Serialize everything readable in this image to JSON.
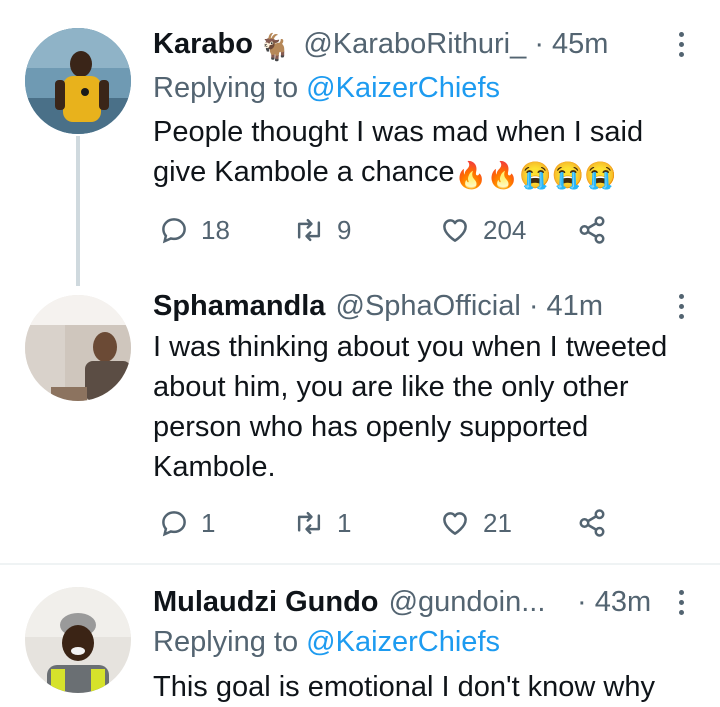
{
  "tweets": [
    {
      "name": "Karabo",
      "name_emoji": "🐐",
      "handle": "@KaraboRithuri_",
      "time": "· 45m",
      "replying_prefix": "Replying to",
      "replying_to": "@KaizerChiefs",
      "text_line1": "People thought I was mad when I said",
      "text_line2": "give Kambole a chance",
      "emojis": [
        "🔥",
        "🔥",
        "😭",
        "😭",
        "😭"
      ],
      "reply_count": "18",
      "retweet_count": "9",
      "like_count": "204"
    },
    {
      "name": "Sphamandla",
      "handle": "@SphaOfficial",
      "time": "· 41m",
      "text": "I was thinking about you when I tweeted about him, you are like the only other person who has openly supported Kambole.",
      "reply_count": "1",
      "retweet_count": "1",
      "like_count": "21"
    },
    {
      "name": "Mulaudzi Gundo",
      "handle": "@gundoin...",
      "time": "· 43m",
      "replying_prefix": "Replying to",
      "replying_to": "@KaizerChiefs",
      "text": "This goal is emotional I don't know why"
    }
  ],
  "colors": {
    "accent": "#1d9bf0",
    "muted": "#536471",
    "text": "#0f1419",
    "border": "#eff3f4"
  }
}
